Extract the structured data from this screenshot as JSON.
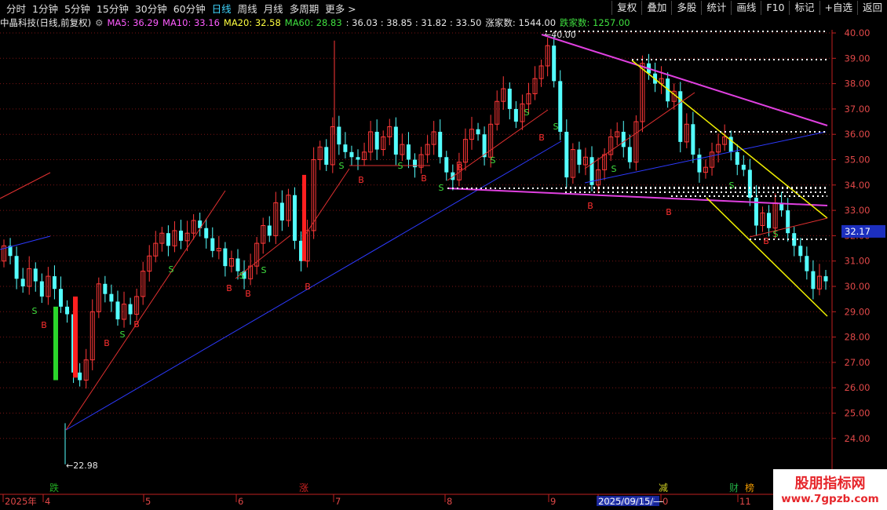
{
  "toolbar": {
    "periods": [
      "分时",
      "1分钟",
      "5分钟",
      "15分钟",
      "30分钟",
      "60分钟",
      "日线",
      "周线",
      "月线",
      "多周期",
      "更多 >"
    ],
    "active_period": "日线",
    "buttons": [
      "复权",
      "叠加",
      "多股",
      "统计",
      "画线",
      "F10",
      "标记",
      "+自选",
      "返回"
    ]
  },
  "info": {
    "title": "中晶科技(日线,前复权)",
    "ma5": "MA5: 36.29",
    "ma10": "MA10: 33.16",
    "ma20": "MA20: 32.58",
    "ma60": "MA60: 28.83",
    "ohlc": ": 36.03 : 38.85 : 31.82 : 33.50",
    "zhangjia": "涨家数: 1544.00",
    "diejia": "跌家数: 1257.00"
  },
  "colors": {
    "up": "#ff3838",
    "down": "#54ffff",
    "ma5": "#ff5cff",
    "ma10": "#ff5cff",
    "ma20": "#ffff40",
    "ma60": "#29d129",
    "grid": "#7a1414",
    "axis_text": "#e04848",
    "blue_line": "#2d3aff",
    "magenta_line": "#e040e0",
    "yellow_line": "#f0f000",
    "red_line": "#e03030"
  },
  "chart_data": {
    "type": "candlestick",
    "y_ticks": [
      "40.00",
      "39.00",
      "38.00",
      "37.00",
      "36.00",
      "35.00",
      "34.00",
      "33.00",
      "32.00",
      "31.00",
      "30.00",
      "29.00",
      "28.00",
      "27.00",
      "26.00",
      "25.00",
      "24.00"
    ],
    "ylim": [
      23.5,
      40.2
    ],
    "current_price": "32.17",
    "high_label": "40.00",
    "low_label": "22.98",
    "x_labels": [
      "2025年",
      "4",
      "5",
      "6",
      "7",
      "8",
      "9",
      "2025/09/15/—",
      "0",
      "11"
    ],
    "event_markers": [
      "跌",
      "涨",
      "减",
      "财",
      "榜"
    ],
    "signal_letters": [
      "B",
      "S"
    ]
  },
  "watermark": {
    "line1": "股朋指标网",
    "line2": "www.7gpzb.com"
  }
}
